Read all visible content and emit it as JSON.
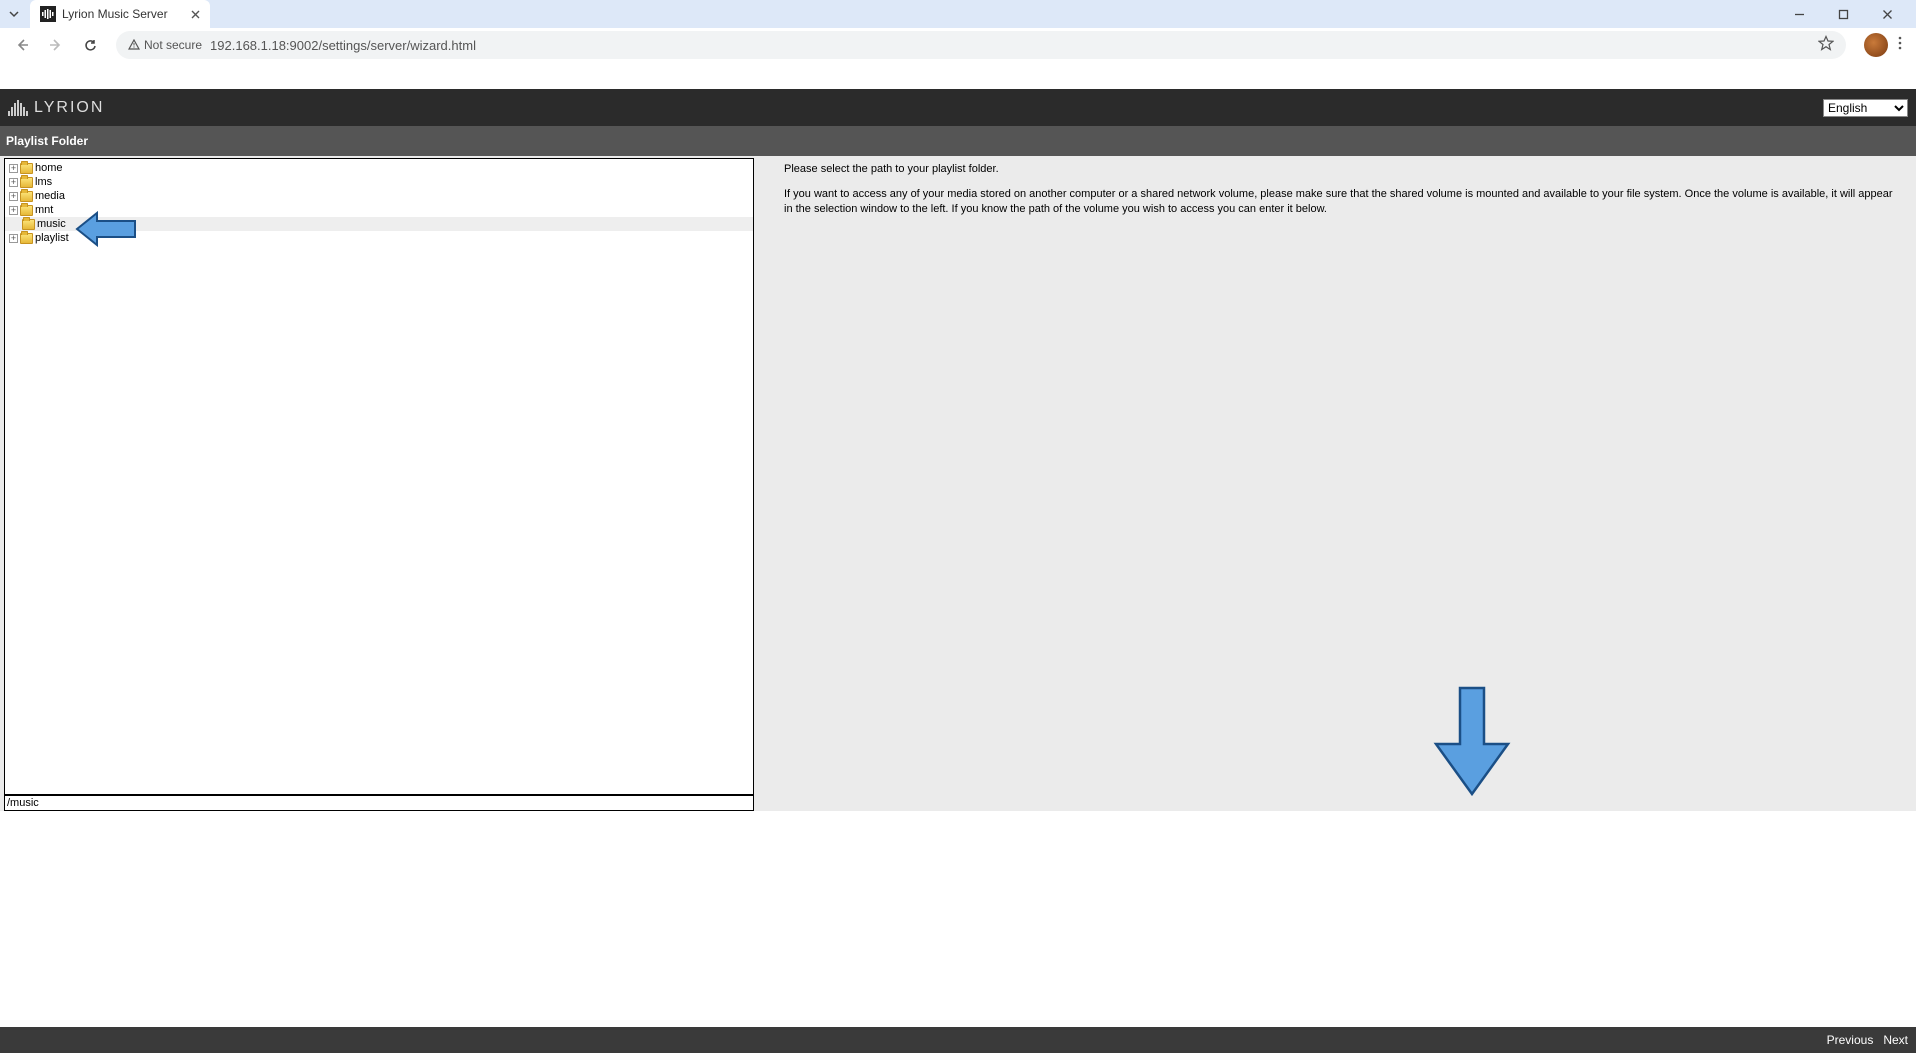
{
  "browser": {
    "tab_title": "Lyrion Music Server",
    "url": "192.168.1.18:9002/settings/server/wizard.html",
    "security_label": "Not secure"
  },
  "header": {
    "brand": "LYRION",
    "language_selected": "English"
  },
  "section": {
    "title": "Playlist Folder"
  },
  "tree": {
    "items": [
      {
        "label": "home",
        "expandable": true
      },
      {
        "label": "lms",
        "expandable": true
      },
      {
        "label": "media",
        "expandable": true
      },
      {
        "label": "mnt",
        "expandable": true
      },
      {
        "label": "music",
        "expandable": false,
        "selected": true
      },
      {
        "label": "playlist",
        "expandable": true
      }
    ],
    "path_value": "/music"
  },
  "instructions": {
    "p1": "Please select the path to your playlist folder.",
    "p2": "If you want to access any of your media stored on another computer or a shared network volume, please make sure that the shared volume is mounted and available to your file system. Once the volume is available, it will appear in the selection window to the left. If you know the path of the volume you wish to access you can enter it below."
  },
  "footer": {
    "previous": "Previous",
    "next": "Next"
  }
}
